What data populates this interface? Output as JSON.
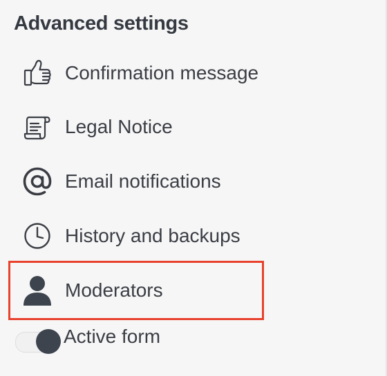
{
  "panel": {
    "title": "Advanced settings",
    "items": [
      {
        "label": "Confirmation message",
        "icon": "thumbs-up-icon"
      },
      {
        "label": "Legal Notice",
        "icon": "scroll-document-icon"
      },
      {
        "label": "Email notifications",
        "icon": "at-sign-icon"
      },
      {
        "label": "History and backups",
        "icon": "clock-icon"
      },
      {
        "label": "Moderators",
        "icon": "user-icon",
        "highlighted": true
      }
    ],
    "toggle": {
      "label": "Active form",
      "state": "on"
    }
  },
  "colors": {
    "text": "#3a3d44",
    "highlight": "#e8412c",
    "background": "#f6f6f6",
    "icon_dark": "#3d444e"
  }
}
